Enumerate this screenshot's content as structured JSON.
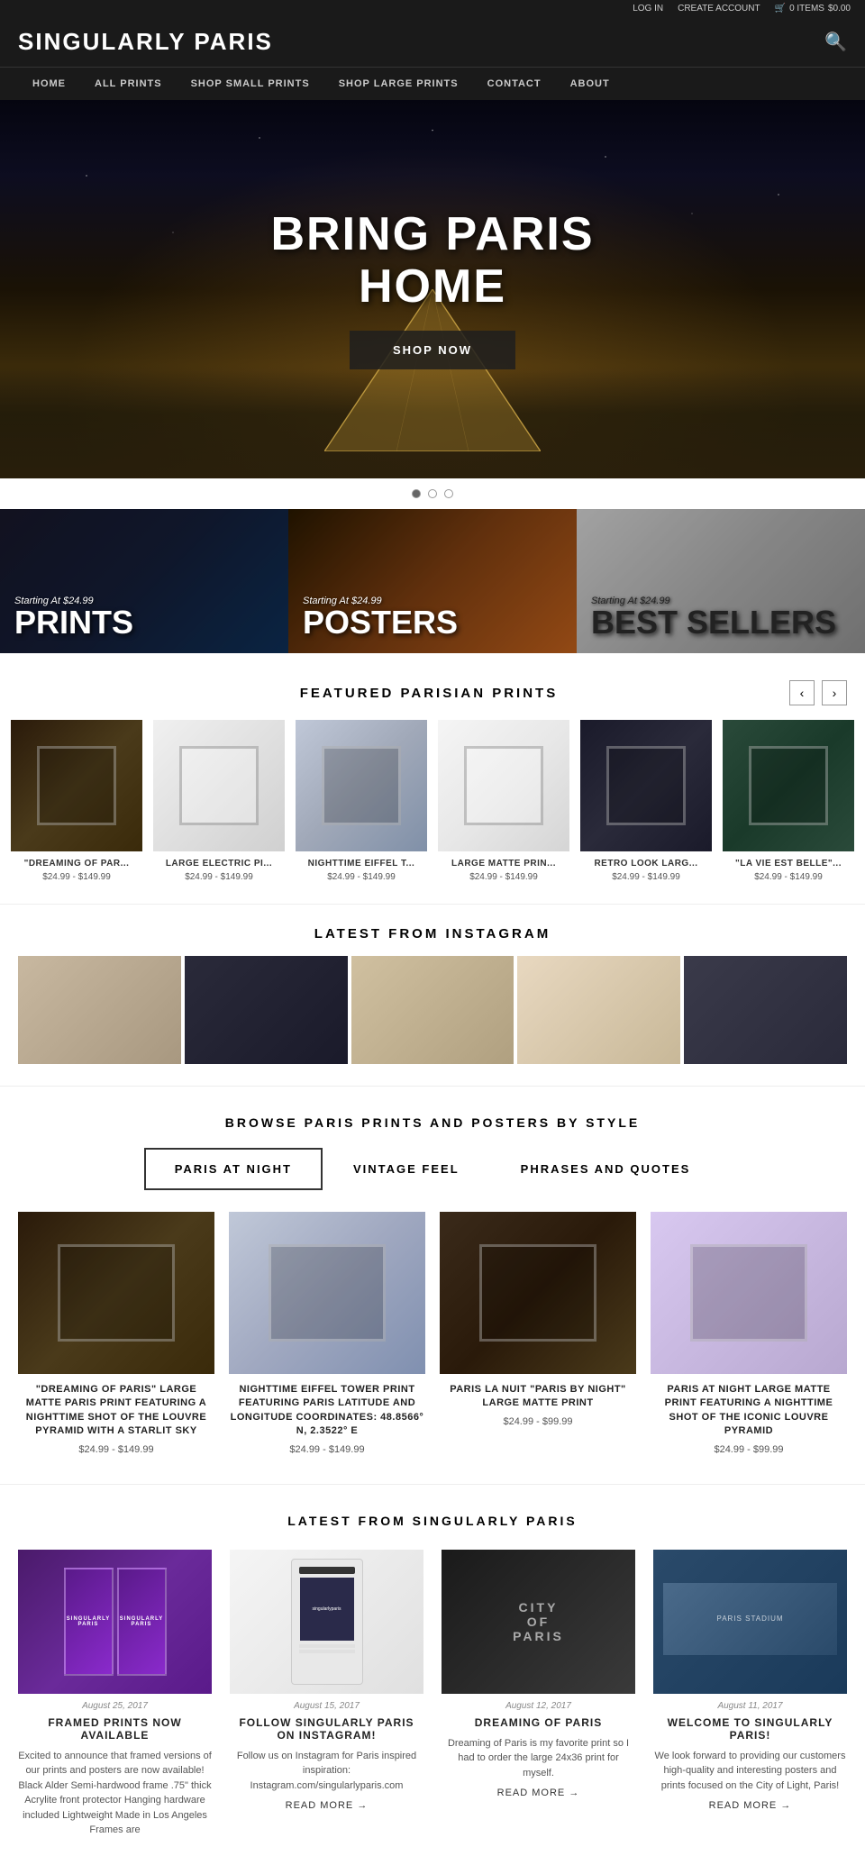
{
  "topbar": {
    "login": "LOG IN",
    "create_account": "CREATE ACCOUNT",
    "cart_items": "0 ITEMS",
    "cart_total": "$0.00"
  },
  "header": {
    "site_title": "SINGULARLY PARIS"
  },
  "nav": {
    "items": [
      {
        "label": "HOME",
        "id": "home"
      },
      {
        "label": "ALL PRINTS",
        "id": "all-prints"
      },
      {
        "label": "SHOP SMALL PRINTS",
        "id": "shop-small-prints"
      },
      {
        "label": "SHOP LARGE PRINTS",
        "id": "shop-large-prints"
      },
      {
        "label": "CONTACT",
        "id": "contact"
      },
      {
        "label": "ABOUT",
        "id": "about"
      }
    ]
  },
  "hero": {
    "headline_line1": "BRING PARIS",
    "headline_line2": "HOME",
    "cta": "SHOP NOW"
  },
  "categories": [
    {
      "id": "prints",
      "starting": "Starting At $24.99",
      "title": "PRINTS"
    },
    {
      "id": "posters",
      "starting": "Starting At $24.99",
      "title": "POSTERS"
    },
    {
      "id": "best-sellers",
      "starting": "Starting At $24.99",
      "title": "BEST SELLERS"
    }
  ],
  "featured": {
    "title": "FEATURED PARISIAN PRINTS",
    "products": [
      {
        "name": "\"DREAMING OF PAR...",
        "price": "$24.99 - $149.99"
      },
      {
        "name": "LARGE ELECTRIC PI...",
        "price": "$24.99 - $149.99"
      },
      {
        "name": "NIGHTTIME EIFFEL T...",
        "price": "$24.99 - $149.99"
      },
      {
        "name": "LARGE MATTE PRIN...",
        "price": "$24.99 - $149.99"
      },
      {
        "name": "RETRO LOOK LARG...",
        "price": "$24.99 - $149.99"
      },
      {
        "name": "\"LA VIE EST BELLE\"...",
        "price": "$24.99 - $149.99"
      }
    ]
  },
  "instagram": {
    "title": "LATEST FROM INSTAGRAM"
  },
  "browse": {
    "title": "BROWSE PARIS PRINTS AND POSTERS BY STYLE",
    "tabs": [
      {
        "label": "PARIS AT NIGHT",
        "active": true
      },
      {
        "label": "VINTAGE FEEL",
        "active": false
      },
      {
        "label": "PHRASES AND QUOTES",
        "active": false
      }
    ],
    "products": [
      {
        "name": "\"DREAMING OF PARIS\" LARGE MATTE PARIS PRINT FEATURING A NIGHTTIME SHOT OF THE LOUVRE PYRAMID WITH A STARLIT SKY",
        "price": "$24.99 - $149.99"
      },
      {
        "name": "NIGHTTIME EIFFEL TOWER PRINT FEATURING PARIS LATITUDE AND LONGITUDE COORDINATES: 48.8566° N, 2.3522° E",
        "price": "$24.99 - $149.99"
      },
      {
        "name": "PARIS LA NUIT \"PARIS BY NIGHT\" LARGE MATTE PRINT",
        "price": "$24.99 - $99.99"
      },
      {
        "name": "PARIS AT NIGHT LARGE MATTE PRINT FEATURING A NIGHTTIME SHOT OF THE ICONIC LOUVRE PYRAMID",
        "price": "$24.99 - $99.99"
      }
    ]
  },
  "latest": {
    "title": "LATEST FROM SINGULARLY PARIS",
    "posts": [
      {
        "date": "August 25, 2017",
        "title": "FRAMED PRINTS NOW AVAILABLE",
        "desc": "Excited to announce that framed versions of our prints and posters are now available! Black Alder Semi-hardwood frame .75\" thick Acrylite front protector Hanging hardware included Lightweight Made in Los Angeles Frames are",
        "read_more": "READ MORE →"
      },
      {
        "date": "August 15, 2017",
        "title": "FOLLOW SINGULARLY PARIS ON INSTAGRAM!",
        "desc": "Follow us on Instagram for Paris inspired inspiration: Instagram.com/singularlyparis.com",
        "read_more": "READ MORE →"
      },
      {
        "date": "August 12, 2017",
        "title": "DREAMING OF PARIS",
        "desc": "Dreaming of Paris is my favorite print so I had to order the large 24x36 print for myself.",
        "read_more": "READ MORE →"
      },
      {
        "date": "August 11, 2017",
        "title": "WELCOME TO SINGULARLY PARIS!",
        "desc": "We look forward to providing our customers high-quality and interesting posters and prints focused on the City of Light, Paris!",
        "read_more": "READ MORE →"
      }
    ]
  }
}
